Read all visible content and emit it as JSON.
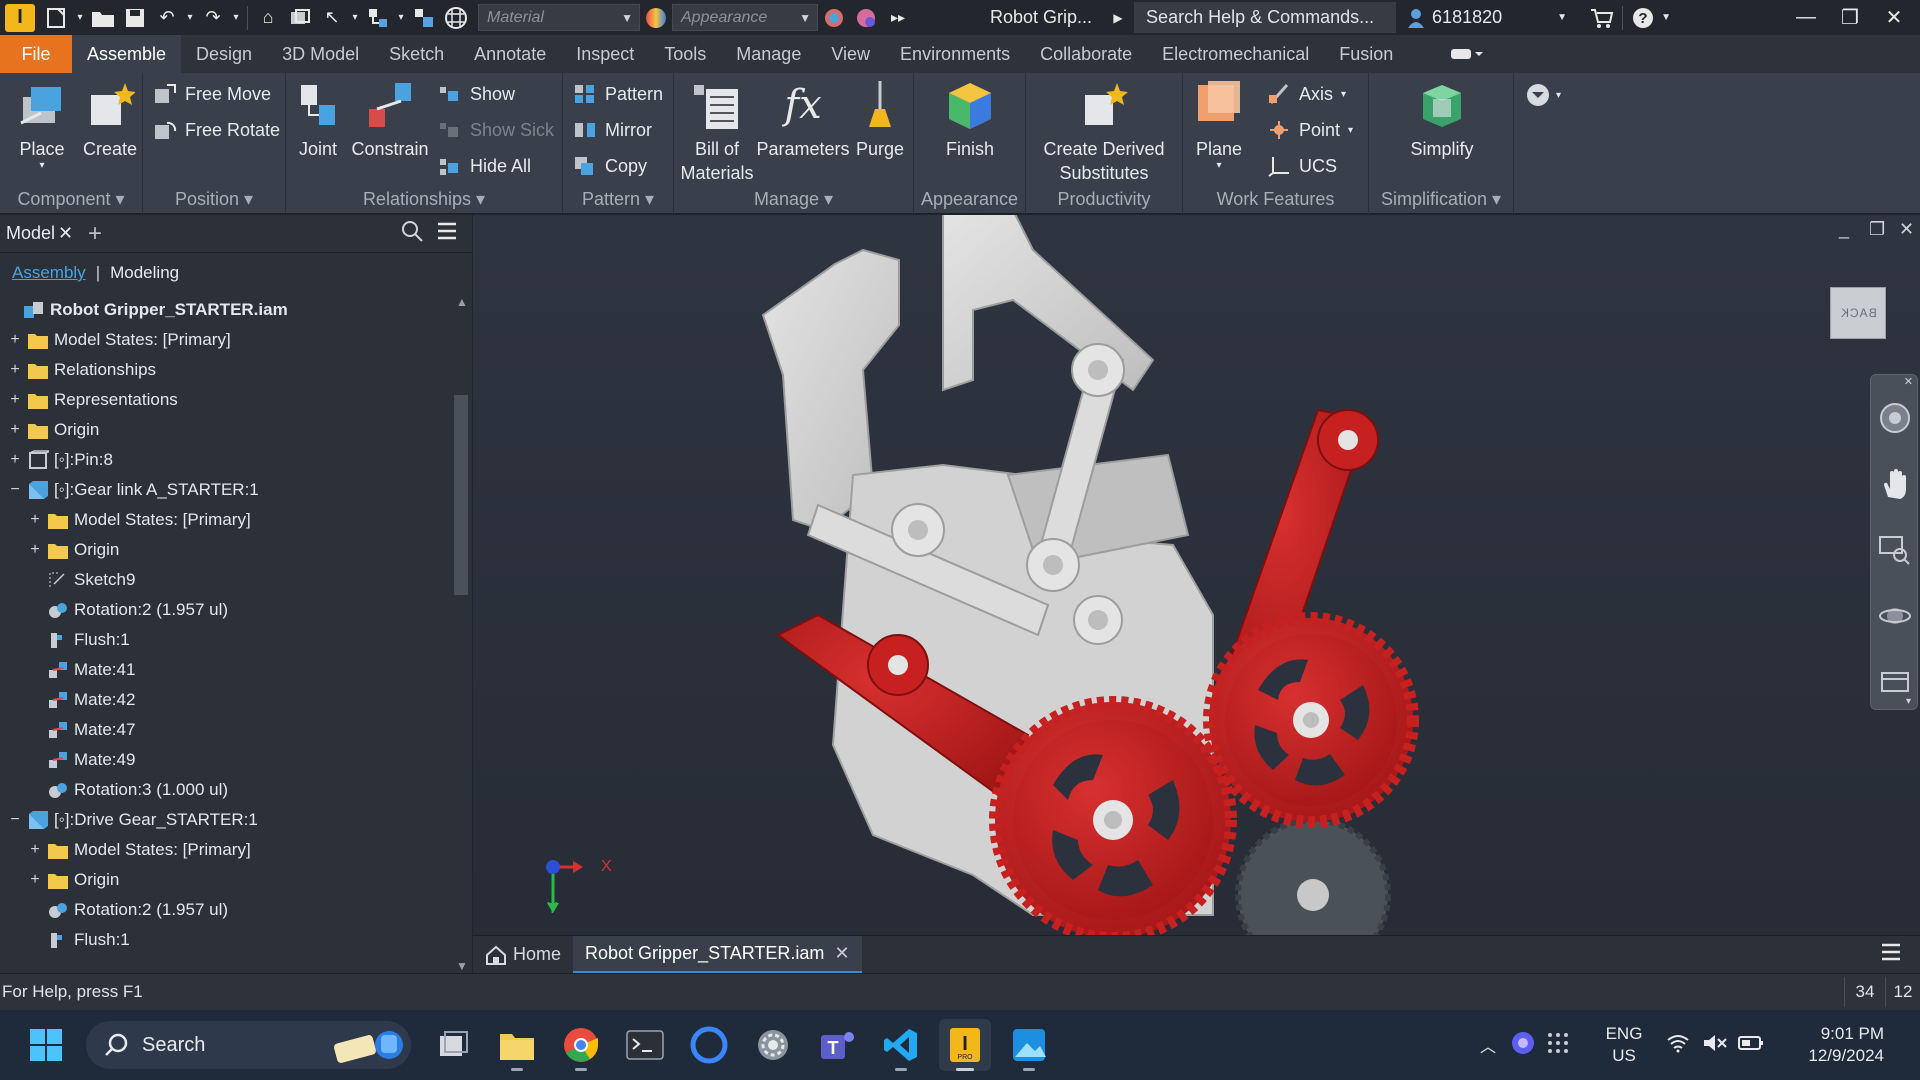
{
  "qat": {
    "material_combo": "Material",
    "appearance_combo": "Appearance",
    "doc_title": "Robot Grip...",
    "search_commands": "Search Help & Commands...",
    "user_id": "6181820",
    "icons": [
      "app-logo-icon",
      "new-icon",
      "open-icon",
      "save-icon",
      "undo-icon",
      "redo-icon",
      "home-icon",
      "return-icon",
      "select-icon",
      "measure-icon",
      "color-icon"
    ]
  },
  "menu_tabs": [
    {
      "label": "File"
    },
    {
      "label": "Assemble"
    },
    {
      "label": "Design"
    },
    {
      "label": "3D Model"
    },
    {
      "label": "Sketch"
    },
    {
      "label": "Annotate"
    },
    {
      "label": "Inspect"
    },
    {
      "label": "Tools"
    },
    {
      "label": "Manage"
    },
    {
      "label": "View"
    },
    {
      "label": "Environments"
    },
    {
      "label": "Collaborate"
    },
    {
      "label": "Electromechanical"
    },
    {
      "label": "Fusion"
    }
  ],
  "ribbon": {
    "component": {
      "label": "Component",
      "place": "Place",
      "create": "Create"
    },
    "position": {
      "label": "Position",
      "free_move": "Free Move",
      "free_rotate": "Free Rotate"
    },
    "relationships": {
      "label": "Relationships",
      "joint": "Joint",
      "constrain": "Constrain",
      "show": "Show",
      "show_sick": "Show Sick",
      "hide_all": "Hide All"
    },
    "pattern": {
      "label": "Pattern",
      "pattern": "Pattern",
      "mirror": "Mirror",
      "copy": "Copy"
    },
    "manage": {
      "label": "Manage",
      "bom1": "Bill of",
      "bom2": "Materials",
      "parameters": "Parameters",
      "purge": "Purge"
    },
    "appearance": {
      "label": "Appearance",
      "finish": "Finish"
    },
    "productivity": {
      "label": "Productivity",
      "cds1": "Create Derived",
      "cds2": "Substitutes"
    },
    "work_features": {
      "label": "Work Features",
      "plane": "Plane",
      "axis": "Axis",
      "point": "Point",
      "ucs": "UCS"
    },
    "simplification": {
      "label": "Simplification",
      "simplify": "Simplify"
    }
  },
  "browser": {
    "tab_label": "Model",
    "mode_assembly": "Assembly",
    "mode_modeling": "Modeling",
    "tree": [
      {
        "label": "Robot Gripper_STARTER.iam",
        "indent": 0,
        "expander": "",
        "icon": "assembly",
        "bold": true
      },
      {
        "label": "Model States: [Primary]",
        "indent": 1,
        "expander": "+",
        "icon": "folder"
      },
      {
        "label": "Relationships",
        "indent": 1,
        "expander": "+",
        "icon": "folder"
      },
      {
        "label": "Representations",
        "indent": 1,
        "expander": "+",
        "icon": "folder"
      },
      {
        "label": "Origin",
        "indent": 1,
        "expander": "+",
        "icon": "folder"
      },
      {
        "label": "[◦]:Pin:8",
        "indent": 1,
        "expander": "+",
        "icon": "part-gray"
      },
      {
        "label": "[◦]:Gear link A_STARTER:1",
        "indent": 1,
        "expander": "−",
        "icon": "part-blue"
      },
      {
        "label": "Model States: [Primary]",
        "indent": 2,
        "expander": "+",
        "icon": "folder"
      },
      {
        "label": "Origin",
        "indent": 2,
        "expander": "+",
        "icon": "folder"
      },
      {
        "label": "Sketch9",
        "indent": 2,
        "expander": "",
        "icon": "sketch"
      },
      {
        "label": "Rotation:2 (1.957 ul)",
        "indent": 2,
        "expander": "",
        "icon": "rotation"
      },
      {
        "label": "Flush:1",
        "indent": 2,
        "expander": "",
        "icon": "flush"
      },
      {
        "label": "Mate:41",
        "indent": 2,
        "expander": "",
        "icon": "mate"
      },
      {
        "label": "Mate:42",
        "indent": 2,
        "expander": "",
        "icon": "mate"
      },
      {
        "label": "Mate:47",
        "indent": 2,
        "expander": "",
        "icon": "mate"
      },
      {
        "label": "Mate:49",
        "indent": 2,
        "expander": "",
        "icon": "mate"
      },
      {
        "label": "Rotation:3 (1.000 ul)",
        "indent": 2,
        "expander": "",
        "icon": "rotation"
      },
      {
        "label": "[◦]:Drive Gear_STARTER:1",
        "indent": 1,
        "expander": "−",
        "icon": "part-blue"
      },
      {
        "label": "Model States: [Primary]",
        "indent": 2,
        "expander": "+",
        "icon": "folder"
      },
      {
        "label": "Origin",
        "indent": 2,
        "expander": "+",
        "icon": "folder"
      },
      {
        "label": "Rotation:2 (1.957 ul)",
        "indent": 2,
        "expander": "",
        "icon": "rotation"
      },
      {
        "label": "Flush:1",
        "indent": 2,
        "expander": "",
        "icon": "flush"
      }
    ]
  },
  "viewport": {
    "viewcube_face": "BACK",
    "triad_x": "X",
    "triad_y": "Y",
    "colors": {
      "gripper_red": "#c62020",
      "frame_gray": "#d4d4d4",
      "gear_dark": "#4a5258",
      "background": "#2c323d"
    }
  },
  "doc_tabs": {
    "home": "Home",
    "active": "Robot Gripper_STARTER.iam"
  },
  "status": {
    "help": "For Help, press F1",
    "count1": "34",
    "count2": "12"
  },
  "taskbar": {
    "search": "Search",
    "lang1": "ENG",
    "lang2": "US",
    "time": "9:01 PM",
    "date": "12/9/2024"
  }
}
